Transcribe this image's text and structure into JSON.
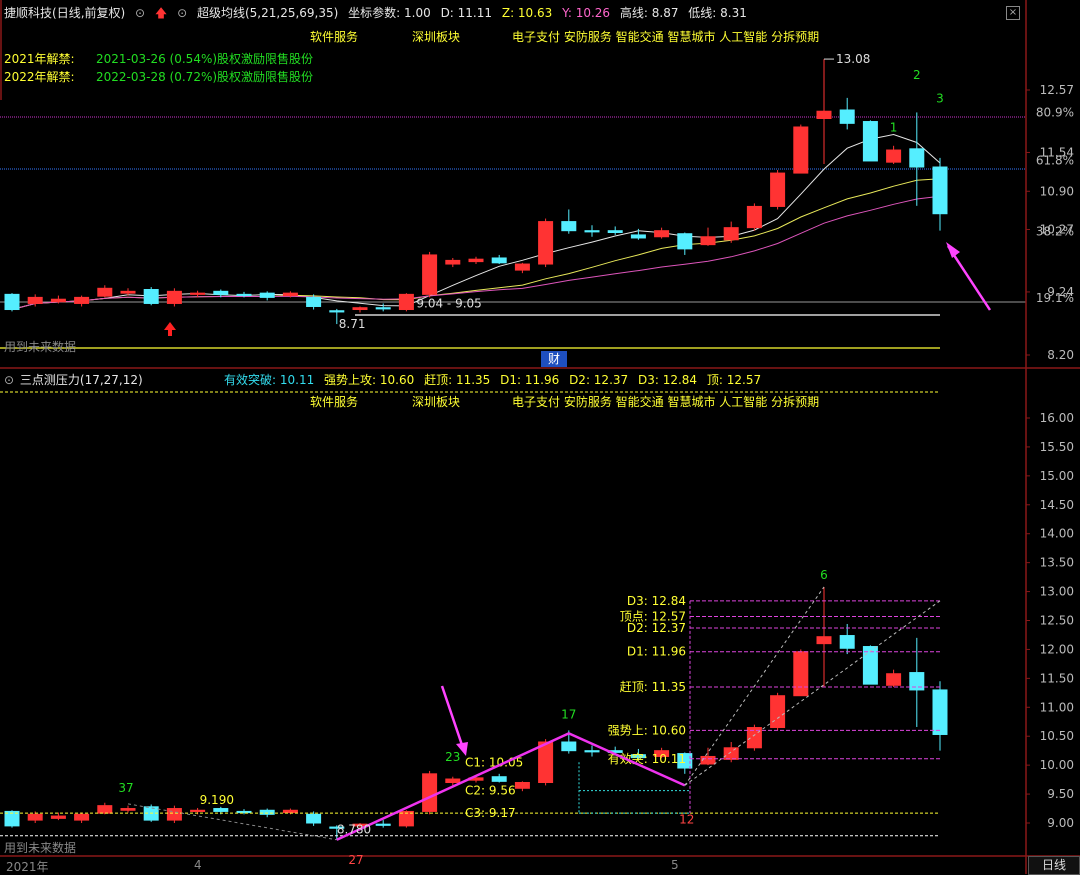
{
  "header": {
    "stock": "捷顺科技",
    "mode": "(日线,前复权)",
    "indicator": "超级均线(5,21,25,69,35)",
    "coord_label": "坐标参数: 1.00",
    "d_val": "D: 11.11",
    "z_val": "Z: 10.63",
    "y_val": "Y: 10.26",
    "high_line": "高线: 8.87",
    "low_line": "低线: 8.31"
  },
  "concepts": {
    "c1": "软件服务",
    "c2": "深圳板块",
    "c3": "电子支付 安防服务 智能交通 智慧城市 人工智能 分拆预期"
  },
  "unlock": [
    {
      "label": "2021年解禁:",
      "text": "2021-03-26 (0.54%)股权激励限售股份"
    },
    {
      "label": "2022年解禁:",
      "text": "2022-03-28 (0.72%)股权激励限售股份"
    }
  ],
  "future_data": "用到未来数据",
  "cai_tag": "财",
  "sub": {
    "name": "三点测压力(17,27,12)",
    "eff_break": "有效突破: 10.11",
    "strong_up": "强势上攻: 10.60",
    "top_chase": "赶顶: 11.35",
    "d1": "D1: 11.96",
    "d2": "D2: 12.37",
    "d3": "D3: 12.84",
    "top": "顶: 12.57"
  },
  "bottom": {
    "year": "2021年",
    "m4": "4",
    "m5": "5",
    "timeframe": "日线"
  },
  "colors": {
    "up": "#ff3333",
    "down": "#55eeff",
    "ma_white": "#e6e6e6",
    "ma_yellow": "#e8e85a",
    "ma_magenta": "#dd55bb",
    "pink_marker": "#ff44ff"
  },
  "chart_data": [
    {
      "type": "candlestick",
      "title": "捷顺科技 日线",
      "y_ticks": [
        12.57,
        11.54,
        10.9,
        10.27,
        9.24,
        8.2
      ],
      "pct_ticks": [
        "80.9%",
        "61.8%",
        "38.2%",
        "19.1%"
      ],
      "pct_levels": [
        12.2,
        11.41,
        10.24,
        9.14
      ],
      "candles": [
        {
          "o": 9.2,
          "c": 8.95,
          "h": 9.22,
          "l": 8.92
        },
        {
          "o": 9.05,
          "c": 9.15,
          "h": 9.2,
          "l": 9.0
        },
        {
          "o": 9.08,
          "c": 9.12,
          "h": 9.18,
          "l": 9.05
        },
        {
          "o": 9.05,
          "c": 9.15,
          "h": 9.18,
          "l": 9.0
        },
        {
          "o": 9.17,
          "c": 9.3,
          "h": 9.35,
          "l": 9.15
        },
        {
          "o": 9.22,
          "c": 9.25,
          "h": 9.3,
          "l": 9.18
        },
        {
          "o": 9.28,
          "c": 9.05,
          "h": 9.32,
          "l": 9.02
        },
        {
          "o": 9.05,
          "c": 9.25,
          "h": 9.3,
          "l": 9.0
        },
        {
          "o": 9.2,
          "c": 9.22,
          "h": 9.26,
          "l": 9.15
        },
        {
          "o": 9.25,
          "c": 9.2,
          "h": 9.28,
          "l": 9.15
        },
        {
          "o": 9.2,
          "c": 9.18,
          "h": 9.24,
          "l": 9.15
        },
        {
          "o": 9.22,
          "c": 9.15,
          "h": 9.25,
          "l": 9.1
        },
        {
          "o": 9.18,
          "c": 9.22,
          "h": 9.25,
          "l": 9.15
        },
        {
          "o": 9.15,
          "c": 9.0,
          "h": 9.2,
          "l": 8.95
        },
        {
          "o": 8.93,
          "c": 8.91,
          "h": 8.96,
          "l": 8.71
        },
        {
          "o": 8.95,
          "c": 8.98,
          "h": 9.0,
          "l": 8.9
        },
        {
          "o": 8.98,
          "c": 8.96,
          "h": 9.05,
          "l": 8.92
        },
        {
          "o": 8.95,
          "c": 9.2,
          "h": 9.22,
          "l": 8.92
        },
        {
          "o": 9.2,
          "c": 9.85,
          "h": 9.9,
          "l": 9.15
        },
        {
          "o": 9.7,
          "c": 9.76,
          "h": 9.8,
          "l": 9.65
        },
        {
          "o": 9.74,
          "c": 9.78,
          "h": 9.82,
          "l": 9.7
        },
        {
          "o": 9.8,
          "c": 9.72,
          "h": 9.85,
          "l": 9.7
        },
        {
          "o": 9.6,
          "c": 9.7,
          "h": 9.72,
          "l": 9.55
        },
        {
          "o": 9.7,
          "c": 10.4,
          "h": 10.45,
          "l": 9.65
        },
        {
          "o": 10.4,
          "c": 10.25,
          "h": 10.6,
          "l": 10.2
        },
        {
          "o": 10.25,
          "c": 10.24,
          "h": 10.34,
          "l": 10.15
        },
        {
          "o": 10.25,
          "c": 10.22,
          "h": 10.32,
          "l": 10.18
        },
        {
          "o": 10.18,
          "c": 10.13,
          "h": 10.28,
          "l": 10.1
        },
        {
          "o": 10.15,
          "c": 10.25,
          "h": 10.3,
          "l": 10.12
        },
        {
          "o": 10.2,
          "c": 9.95,
          "h": 10.22,
          "l": 9.85
        },
        {
          "o": 10.02,
          "c": 10.15,
          "h": 10.3,
          "l": 10.0
        },
        {
          "o": 10.1,
          "c": 10.3,
          "h": 10.4,
          "l": 10.05
        },
        {
          "o": 10.3,
          "c": 10.65,
          "h": 10.7,
          "l": 10.25
        },
        {
          "o": 10.65,
          "c": 11.2,
          "h": 11.25,
          "l": 10.6
        },
        {
          "o": 11.2,
          "c": 11.96,
          "h": 12.0,
          "l": 11.2
        },
        {
          "o": 12.1,
          "c": 12.22,
          "h": 13.08,
          "l": 11.35
        },
        {
          "o": 12.24,
          "c": 12.02,
          "h": 12.44,
          "l": 11.92
        },
        {
          "o": 12.05,
          "c": 11.4,
          "h": 12.07,
          "l": 11.4
        },
        {
          "o": 11.38,
          "c": 11.58,
          "h": 11.65,
          "l": 11.35
        },
        {
          "o": 11.6,
          "c": 11.3,
          "h": 12.2,
          "l": 10.66
        },
        {
          "o": 11.3,
          "c": 10.53,
          "h": 11.45,
          "l": 10.25
        }
      ],
      "annotations": {
        "high": "13.08",
        "low": "8.71",
        "range": "9.04 - 9.05",
        "labels": [
          "1",
          "2",
          "3"
        ]
      }
    },
    {
      "type": "candlestick",
      "title": "三点测压力(17,27,12)",
      "y_ticks": [
        16.0,
        15.5,
        15.0,
        14.5,
        14.0,
        13.5,
        13.0,
        12.5,
        12.0,
        11.5,
        11.0,
        10.5,
        10.0,
        9.5,
        9.0
      ],
      "levels": [
        {
          "label": "D3: 12.84",
          "value": 12.84
        },
        {
          "label": "顶点: 12.57",
          "value": 12.57
        },
        {
          "label": "D2: 12.37",
          "value": 12.37
        },
        {
          "label": "D1: 11.96",
          "value": 11.96
        },
        {
          "label": "赶顶: 11.35",
          "value": 11.35
        },
        {
          "label": "强势上: 10.60",
          "value": 10.6
        },
        {
          "label": "有效突: 10.11",
          "value": 10.11
        },
        {
          "label": "C1: 10.05",
          "value": 10.05
        },
        {
          "label": "C2: 9.56",
          "value": 9.56
        },
        {
          "label": "C3: 9.17",
          "value": 9.17
        }
      ],
      "pivots": [
        {
          "label": "37",
          "value": 9.33
        },
        {
          "label": "9.190",
          "value": 9.19
        },
        {
          "label": "27",
          "value": 8.71
        },
        {
          "label": "8.780",
          "value": 8.78
        },
        {
          "label": "23",
          "value": 9.9
        },
        {
          "label": "17",
          "value": 10.6
        },
        {
          "label": "12",
          "value": 9.65
        },
        {
          "label": "6",
          "value": 13.08
        }
      ]
    }
  ]
}
